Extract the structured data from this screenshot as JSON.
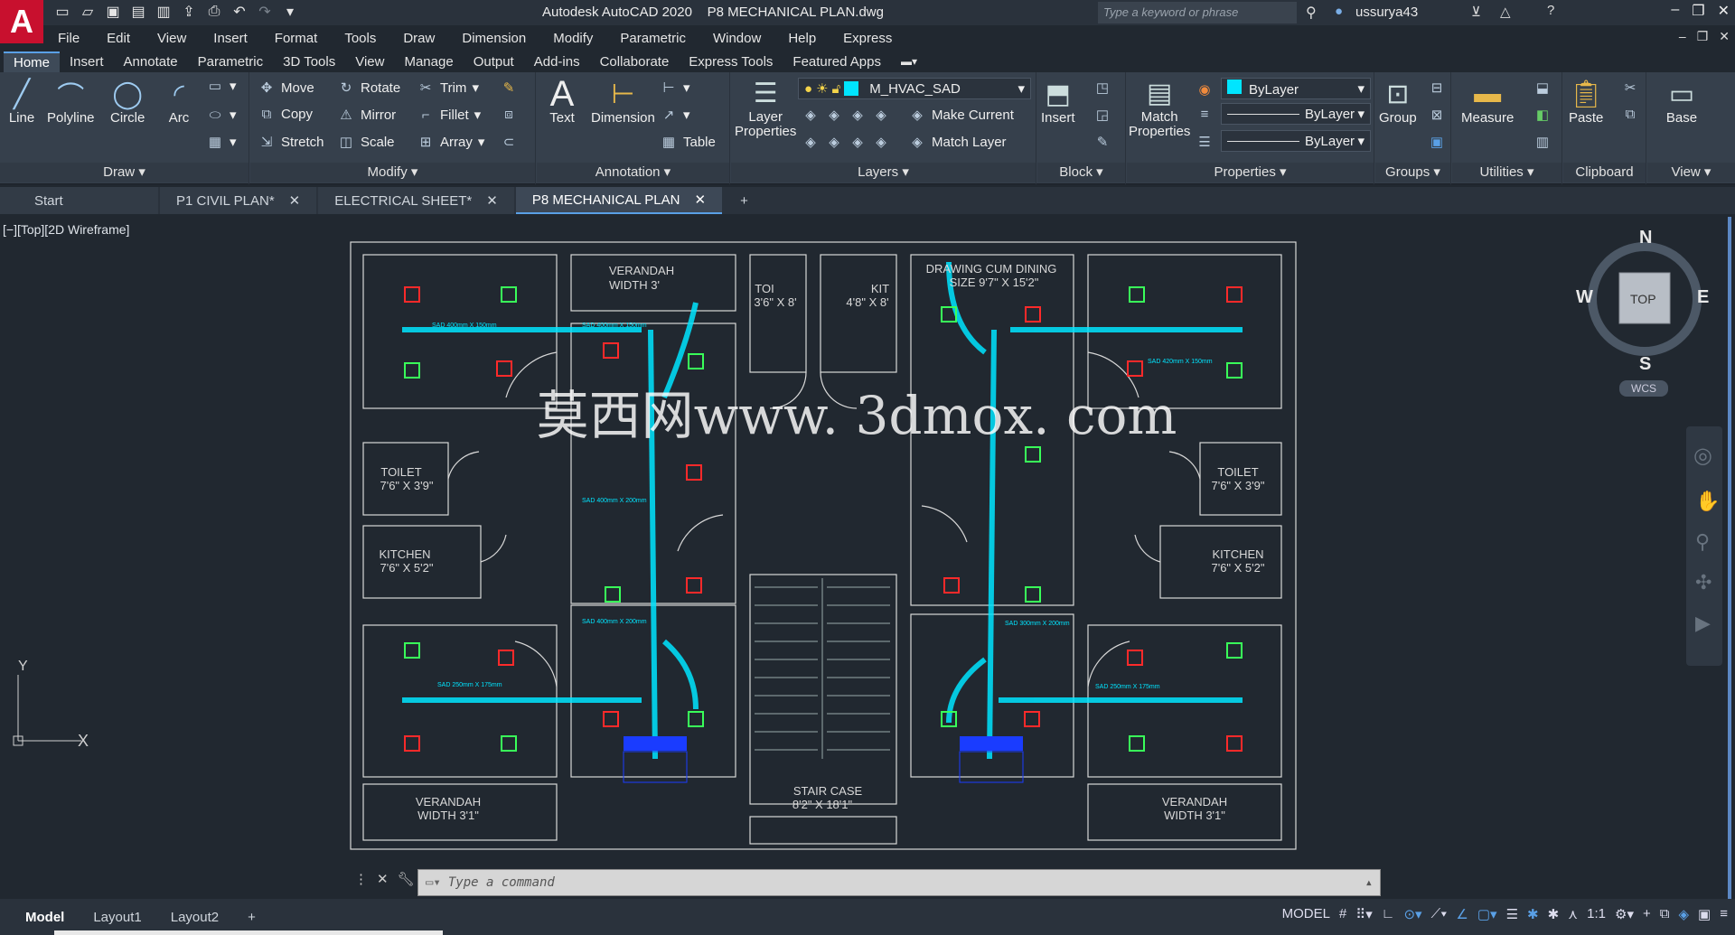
{
  "app": {
    "title": "Autodesk AutoCAD 2020    P8 MECHANICAL PLAN.dwg",
    "logo": "A",
    "search_placeholder": "Type a keyword or phrase",
    "user": "ussurya43"
  },
  "menu": [
    "File",
    "Edit",
    "View",
    "Insert",
    "Format",
    "Tools",
    "Draw",
    "Dimension",
    "Modify",
    "Parametric",
    "Window",
    "Help",
    "Express"
  ],
  "ribbon_tabs": [
    "Home",
    "Insert",
    "Annotate",
    "Parametric",
    "3D Tools",
    "View",
    "Manage",
    "Output",
    "Add-ins",
    "Collaborate",
    "Express Tools",
    "Featured Apps"
  ],
  "panels": {
    "draw": {
      "title": "Draw",
      "line": "Line",
      "polyline": "Polyline",
      "circle": "Circle",
      "arc": "Arc"
    },
    "modify": {
      "title": "Modify",
      "move": "Move",
      "rotate": "Rotate",
      "trim": "Trim",
      "copy": "Copy",
      "mirror": "Mirror",
      "fillet": "Fillet",
      "stretch": "Stretch",
      "scale": "Scale",
      "array": "Array"
    },
    "annotation": {
      "title": "Annotation",
      "text": "Text",
      "dimension": "Dimension",
      "table": "Table"
    },
    "layers": {
      "title": "Layers",
      "layer_properties_1": "Layer",
      "layer_properties_2": "Properties",
      "current_layer": "M_HVAC_SAD",
      "make_current": "Make Current",
      "match_layer": "Match Layer"
    },
    "block": {
      "title": "Block",
      "insert": "Insert"
    },
    "properties": {
      "title": "Properties",
      "match_1": "Match",
      "match_2": "Properties",
      "color": "ByLayer",
      "linetype": "ByLayer",
      "lineweight": "ByLayer"
    },
    "groups": {
      "title": "Groups",
      "group": "Group"
    },
    "utilities": {
      "title": "Utilities",
      "measure": "Measure"
    },
    "clipboard": {
      "title": "Clipboard",
      "paste": "Paste"
    },
    "view": {
      "title": "View",
      "base": "Base"
    }
  },
  "doc_tabs": [
    "Start",
    "P1 CIVIL PLAN*",
    "ELECTRICAL SHEET*",
    "P8 MECHANICAL PLAN"
  ],
  "viewport_label": "[−][Top][2D Wireframe]",
  "viewcube": {
    "n": "N",
    "s": "S",
    "e": "E",
    "w": "W",
    "top": "TOP",
    "wcs": "WCS"
  },
  "ucs": {
    "x": "X",
    "y": "Y"
  },
  "drawing": {
    "watermark": "莫西网www. 3dmox. com",
    "rooms": [
      {
        "name": "VERANDAH",
        "size": "WIDTH 3'"
      },
      {
        "name": "TOI",
        "size": "3'6\" X 8'"
      },
      {
        "name": "KIT",
        "size": "4'8\" X 8'"
      },
      {
        "name": "DRAWING CUM DINING",
        "size": "SIZE 9'7\" X 15'2\""
      },
      {
        "name": "TOILET",
        "size": "7'6\" X 3'9\""
      },
      {
        "name": "TOILET",
        "size": "7'6\" X 3'9\""
      },
      {
        "name": "KITCHEN",
        "size": "7'6\" X 5'2\""
      },
      {
        "name": "KITCHEN",
        "size": "7'6\" X 5'2\""
      },
      {
        "name": "VERANDAH",
        "size": "WIDTH 3'1\""
      },
      {
        "name": "STAIR CASE",
        "size": "8'2\" X 18'1\""
      },
      {
        "name": "VERANDAH",
        "size": "WIDTH 3'1\""
      }
    ],
    "duct_labels": [
      "SAD 400mm X 150mm",
      "SAD 400mm X 150mm",
      "SAD 420mm X 150mm",
      "SAD 400mm X 200mm",
      "SAD 400mm X 200mm",
      "SAD 250mm X 175mm",
      "SAD 250mm X 175mm",
      "SAD 300mm X 200mm"
    ]
  },
  "command": {
    "placeholder": "Type a command"
  },
  "layout_tabs": [
    "Model",
    "Layout1",
    "Layout2"
  ],
  "status": {
    "model": "MODEL",
    "scale": "1:1"
  }
}
